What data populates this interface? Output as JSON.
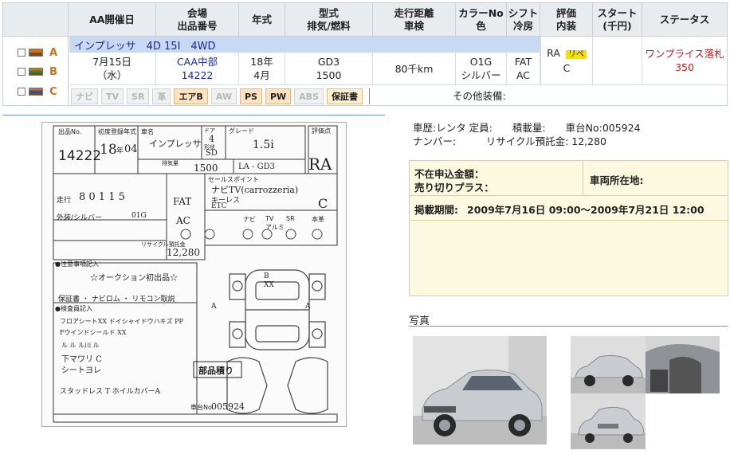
{
  "header": {
    "col_date": "AA開催日",
    "col_venue_line1": "会場",
    "col_venue_line2": "出品番号",
    "col_year": "年式",
    "col_model_line1": "型式",
    "col_model_line2": "排気/燃料",
    "col_mileage_line1": "走行距離",
    "col_mileage_line2": "車検",
    "col_color_line1": "カラーNo",
    "col_color_line2": "色",
    "col_shift_line1": "シフト",
    "col_shift_line2": "冷房",
    "col_grade_line1": "評価",
    "col_grade_line2": "内装",
    "col_start_line1": "スタート",
    "col_start_line2": "(千円)",
    "col_status": "ステータス"
  },
  "left_labels": [
    "A",
    "B",
    "C"
  ],
  "listing": {
    "title": "インプレッサ　4D 15I　4WD",
    "date": "7月15日",
    "weekday": "（水）",
    "venue": "CAA中部",
    "lot_no": "14222",
    "year": "18年",
    "month": "4月",
    "model": "GD3",
    "displacement": "1500",
    "mileage": "80千km",
    "color_no": "O1G",
    "color_name": "シルバー",
    "shift": "FAT",
    "ac": "AC",
    "grade": "RA",
    "grade_tag": "リペ",
    "interior": "C",
    "status": "ワンプライス落札",
    "status_price": "350",
    "other_equipment_label": "その他装備:"
  },
  "badges": [
    {
      "label": "ナビ",
      "on": false
    },
    {
      "label": "TV",
      "on": false
    },
    {
      "label": "SR",
      "on": false
    },
    {
      "label": "革",
      "on": false
    },
    {
      "label": "エアB",
      "on": true
    },
    {
      "label": "AW",
      "on": false
    },
    {
      "label": "PS",
      "on": true
    },
    {
      "label": "PW",
      "on": true
    },
    {
      "label": "ABS",
      "on": false
    },
    {
      "label": "保証書",
      "on": true
    }
  ],
  "info": {
    "line1": "車歴:レンタ  定員:　　積載量:　　車台No:005924",
    "line2": "ナンバー:　　　リサイクル預託金: 12,280"
  },
  "box": {
    "absentee_label": "不在申込金額：",
    "sold_plus_label": "売り切りプラス：",
    "location_label": "車両所在地:",
    "period_label": "掲載期間:",
    "period_value": "2009年7月16日 09:00～2009年7月21日 12:00"
  },
  "photos_title": "写真",
  "sheet": {
    "lot_label": "出品No.",
    "lot_no": "14222",
    "first_reg_label": "初度登録年式",
    "year_hw": "18",
    "year_unit": "年",
    "month_hw": "04",
    "name_label": "車名",
    "name_hw": "インプレッサ",
    "door_label": "ドア",
    "door_hw": "4",
    "grade_label": "グレード",
    "grade_hw": "1.5i",
    "score_label": "評価点",
    "score_hw": "RA",
    "shape_label": "形状",
    "shape_hw": "SD",
    "disp_label": "排気量",
    "disp_hw": "1500",
    "model_hw": "LA  -  GD3",
    "mileage_label": "走行",
    "mileage_hw": "8 0 1 1 5",
    "color_label": "外装/シルバー",
    "color_no": "01G",
    "shift_hw": "FAT",
    "ac_hw": "AC",
    "sales_point_label": "セールスポイント",
    "sales_point_line1": "ナビTV(carrozzeria)",
    "sales_point_line2": "キーレス",
    "sales_point_line3": "ETC",
    "interior_hw": "C",
    "recycle_label": "リサイクル預託金",
    "recycle_value": "12,280",
    "notes_label": "●注意事項記入",
    "notes_hw": "☆オークション初出品☆",
    "equipment_hw": "保証書 ・ ナビロム ・ リモコン取説",
    "inspector_label": "●検査員記入",
    "insp_line1": "フロアシートXX  ドイシャイドウハキズ PP",
    "insp_line2": "Fウインドシールド XX",
    "insp_line3": "ル ル  ル川  ル",
    "insp_line4": "下マワリ C",
    "insp_line5": "シートヨレ",
    "parts_hw": "部品積り",
    "insp_line6": "スタッドレス T  ホイルカバーA",
    "chassis_label": "車台No.",
    "chassis_value": "005924",
    "opt_nav": "ナビ",
    "opt_tv": "TV",
    "opt_sr": "SR",
    "opt_leather": "本革",
    "opt_aw": "アルミ",
    "mark_a": "A",
    "mark_b": "B",
    "mark_x": "XX"
  }
}
